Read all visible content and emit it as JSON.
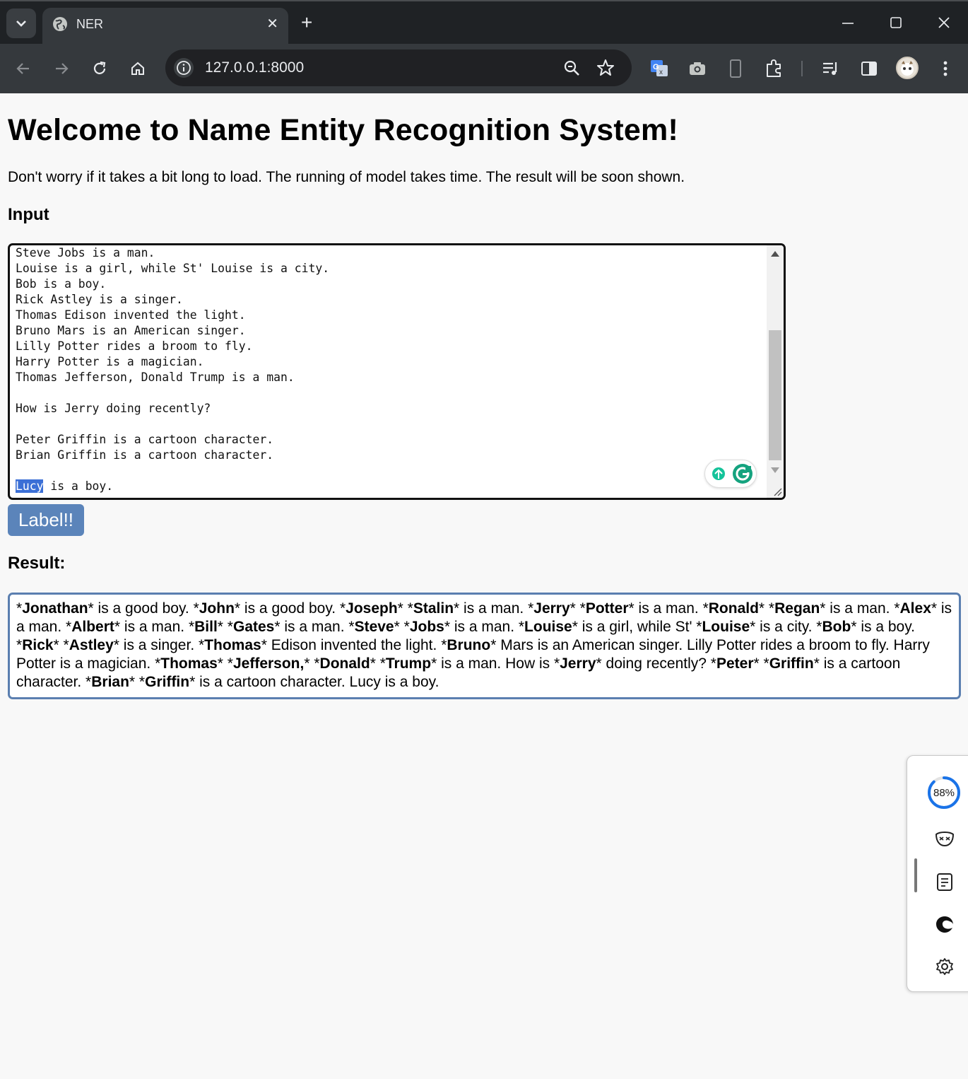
{
  "browser": {
    "tab_title": "NER",
    "url": "127.0.0.1:8000"
  },
  "page": {
    "heading": "Welcome to Name Entity Recognition System!",
    "subtitle": "Don't worry if it takes a bit long to load. The running of model takes time. The result will be soon shown.",
    "input_label": "Input",
    "textarea_lines": [
      "Steve Jobs is a man.",
      "Louise is a girl, while St' Louise is a city.",
      "Bob is a boy.",
      "Rick Astley is a singer.",
      "Thomas Edison invented the light.",
      "Bruno Mars is an American singer.",
      "Lilly Potter rides a broom to fly.",
      "Harry Potter is a magician.",
      "Thomas Jefferson, Donald Trump is a man.",
      "",
      "How is Jerry doing recently?",
      "",
      "Peter Griffin is a cartoon character.",
      "Brian Griffin is a cartoon character.",
      ""
    ],
    "textarea_last_selected": "Lucy",
    "textarea_last_rest": " is a boy.",
    "button_label": "Label!!",
    "result_label": "Result:",
    "result_segments": [
      {
        "t": "*",
        "b": false
      },
      {
        "t": "Jonathan",
        "b": true
      },
      {
        "t": "* is a good boy. *",
        "b": false
      },
      {
        "t": "John",
        "b": true
      },
      {
        "t": "* is a good boy. *",
        "b": false
      },
      {
        "t": "Joseph",
        "b": true
      },
      {
        "t": "* *",
        "b": false
      },
      {
        "t": "Stalin",
        "b": true
      },
      {
        "t": "* is a man. *",
        "b": false
      },
      {
        "t": "Jerry",
        "b": true
      },
      {
        "t": "* *",
        "b": false
      },
      {
        "t": "Potter",
        "b": true
      },
      {
        "t": "* is a man. *",
        "b": false
      },
      {
        "t": "Ronald",
        "b": true
      },
      {
        "t": "* *",
        "b": false
      },
      {
        "t": "Regan",
        "b": true
      },
      {
        "t": "* is a man. *",
        "b": false
      },
      {
        "t": "Alex",
        "b": true
      },
      {
        "t": "* is a man. *",
        "b": false
      },
      {
        "t": "Albert",
        "b": true
      },
      {
        "t": "* is a man. *",
        "b": false
      },
      {
        "t": "Bill",
        "b": true
      },
      {
        "t": "* *",
        "b": false
      },
      {
        "t": "Gates",
        "b": true
      },
      {
        "t": "* is a man. *",
        "b": false
      },
      {
        "t": "Steve",
        "b": true
      },
      {
        "t": "* *",
        "b": false
      },
      {
        "t": "Jobs",
        "b": true
      },
      {
        "t": "* is a man. *",
        "b": false
      },
      {
        "t": "Louise",
        "b": true
      },
      {
        "t": "* is a girl, while St' *",
        "b": false
      },
      {
        "t": "Louise",
        "b": true
      },
      {
        "t": "* is a city. *",
        "b": false
      },
      {
        "t": "Bob",
        "b": true
      },
      {
        "t": "* is a boy. *",
        "b": false
      },
      {
        "t": "Rick",
        "b": true
      },
      {
        "t": "* *",
        "b": false
      },
      {
        "t": "Astley",
        "b": true
      },
      {
        "t": "* is a singer. *",
        "b": false
      },
      {
        "t": "Thomas",
        "b": true
      },
      {
        "t": "* Edison invented the light. *",
        "b": false
      },
      {
        "t": "Bruno",
        "b": true
      },
      {
        "t": "* Mars is an American singer. Lilly Potter rides a broom to fly. Harry Potter is a magician. *",
        "b": false
      },
      {
        "t": "Thomas",
        "b": true
      },
      {
        "t": "* *",
        "b": false
      },
      {
        "t": "Jefferson,",
        "b": true
      },
      {
        "t": "* *",
        "b": false
      },
      {
        "t": "Donald",
        "b": true
      },
      {
        "t": "* *",
        "b": false
      },
      {
        "t": "Trump",
        "b": true
      },
      {
        "t": "* is a man. How is *",
        "b": false
      },
      {
        "t": "Jerry",
        "b": true
      },
      {
        "t": "* doing recently? *",
        "b": false
      },
      {
        "t": "Peter",
        "b": true
      },
      {
        "t": "* *",
        "b": false
      },
      {
        "t": "Griffin",
        "b": true
      },
      {
        "t": "* is a cartoon character. *",
        "b": false
      },
      {
        "t": "Brian",
        "b": true
      },
      {
        "t": "* *",
        "b": false
      },
      {
        "t": "Griffin",
        "b": true
      },
      {
        "t": "* is a cartoon character. Lucy is a boy.",
        "b": false
      }
    ]
  },
  "side_panel": {
    "gauge_value": 88,
    "gauge_text": "88%",
    "items": [
      "gauge-icon",
      "mask-icon",
      "notes-icon",
      "edge-icon",
      "gear-icon"
    ]
  },
  "colors": {
    "button_bg": "#5b84ba",
    "result_border": "#5b7fb0",
    "selection": "#3b6fd6",
    "gauge": "#1a73e8"
  }
}
